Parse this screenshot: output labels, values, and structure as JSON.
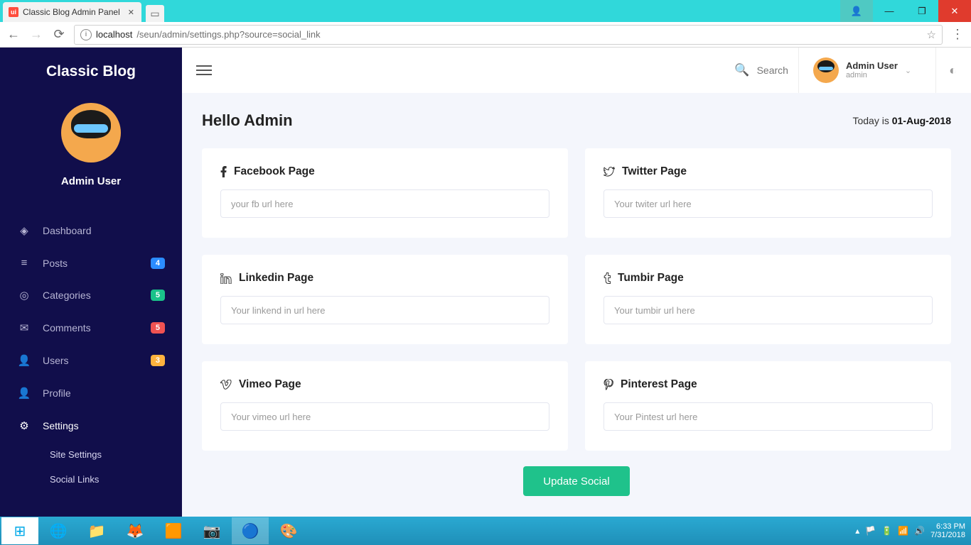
{
  "browser": {
    "tab_title": "Classic Blog Admin Panel",
    "url_host": "localhost",
    "url_path": "/seun/admin/settings.php?source=social_link"
  },
  "sidebar": {
    "site_title": "Classic Blog",
    "user_name": "Admin User",
    "items": [
      {
        "icon": "◈",
        "label": "Dashboard",
        "badge": "",
        "badge_cls": ""
      },
      {
        "icon": "≡",
        "label": "Posts",
        "badge": "4",
        "badge_cls": "b-blue"
      },
      {
        "icon": "◎",
        "label": "Categories",
        "badge": "5",
        "badge_cls": "b-green"
      },
      {
        "icon": "✉",
        "label": "Comments",
        "badge": "5",
        "badge_cls": "b-red"
      },
      {
        "icon": "👤",
        "label": "Users",
        "badge": "3",
        "badge_cls": "b-orange"
      },
      {
        "icon": "👤",
        "label": "Profile",
        "badge": "",
        "badge_cls": ""
      },
      {
        "icon": "⚙",
        "label": "Settings",
        "badge": "",
        "badge_cls": "",
        "active": true
      }
    ],
    "sub_items": [
      "Site Settings",
      "Social Links"
    ]
  },
  "topbar": {
    "search_placeholder": "Search",
    "user_name": "Admin User",
    "user_role": "admin"
  },
  "content": {
    "greeting": "Hello Admin",
    "today_prefix": "Today is ",
    "today_date": "01-Aug-2018",
    "cards": [
      {
        "icon": "f",
        "title": "Facebook Page",
        "placeholder": "your fb url here"
      },
      {
        "icon": "t",
        "title": "Twitter Page",
        "placeholder": "Your twiter url here"
      },
      {
        "icon": "in",
        "title": "Linkedin Page",
        "placeholder": "Your linkend in url here"
      },
      {
        "icon": "t",
        "title": "Tumbir Page",
        "placeholder": "Your tumbir url here"
      },
      {
        "icon": "v",
        "title": "Vimeo Page",
        "placeholder": "Your vimeo url here"
      },
      {
        "icon": "p",
        "title": "Pinterest Page",
        "placeholder": "Your Pintest url here"
      }
    ],
    "button_label": "Update Social"
  },
  "taskbar": {
    "time": "6:33 PM",
    "date": "7/31/2018"
  }
}
